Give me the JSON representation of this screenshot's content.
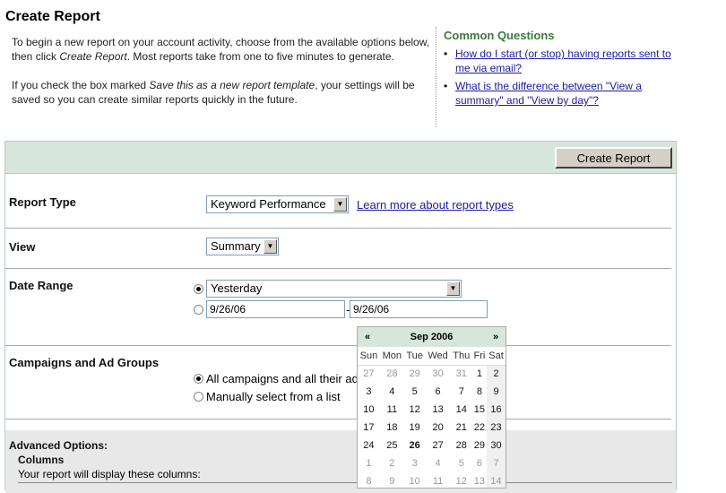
{
  "page_title": "Create Report",
  "intro": {
    "p1_a": "To begin a new report on your account activity, choose from the available options below, then click ",
    "p1_em": "Create Report",
    "p1_b": ". Most reports take from one to five minutes to generate.",
    "p2_a": "If you check the box marked ",
    "p2_em": "Save this as a new report template",
    "p2_b": ", your settings will be saved so you can create similar reports quickly in the future."
  },
  "faq": {
    "title": "Common Questions",
    "items": [
      "How do I start (or stop) having reports sent to me via email?",
      "What is the difference between \"View a summary\" and \"View by day\"?"
    ]
  },
  "panel": {
    "create_button": "Create Report",
    "report_type": {
      "label": "Report Type",
      "value": "Keyword Performance",
      "learn_more": "Learn more about report types"
    },
    "view": {
      "label": "View",
      "value": "Summary"
    },
    "date_range": {
      "label": "Date Range",
      "preset": "Yesterday",
      "from": "9/26/06",
      "separator": "-",
      "to": "9/26/06"
    },
    "campaigns": {
      "label": "Campaigns and Ad Groups",
      "option_all": "All campaigns and all their ad",
      "option_manual": "Manually select from a list"
    },
    "advanced": {
      "label": "Advanced Options:",
      "columns_label": "Columns",
      "columns_desc": "Your report will display these columns:"
    }
  },
  "calendar": {
    "prev": "«",
    "next": "»",
    "month": "Sep 2006",
    "weekdays": [
      "Sun",
      "Mon",
      "Tue",
      "Wed",
      "Thu",
      "Fri",
      "Sat"
    ],
    "weeks": [
      [
        "27",
        "28",
        "29",
        "30",
        "31",
        "1",
        "2"
      ],
      [
        "3",
        "4",
        "5",
        "6",
        "7",
        "8",
        "9"
      ],
      [
        "10",
        "11",
        "12",
        "13",
        "14",
        "15",
        "16"
      ],
      [
        "17",
        "18",
        "19",
        "20",
        "21",
        "22",
        "23"
      ],
      [
        "24",
        "25",
        "26",
        "27",
        "28",
        "29",
        "30"
      ],
      [
        "1",
        "2",
        "3",
        "4",
        "5",
        "6",
        "7"
      ],
      [
        "8",
        "9",
        "10",
        "11",
        "12",
        "13",
        "14"
      ]
    ]
  },
  "icons": {
    "dropdown_arrow": "dropdown-arrow-icon",
    "bullet": "bullet-icon"
  }
}
